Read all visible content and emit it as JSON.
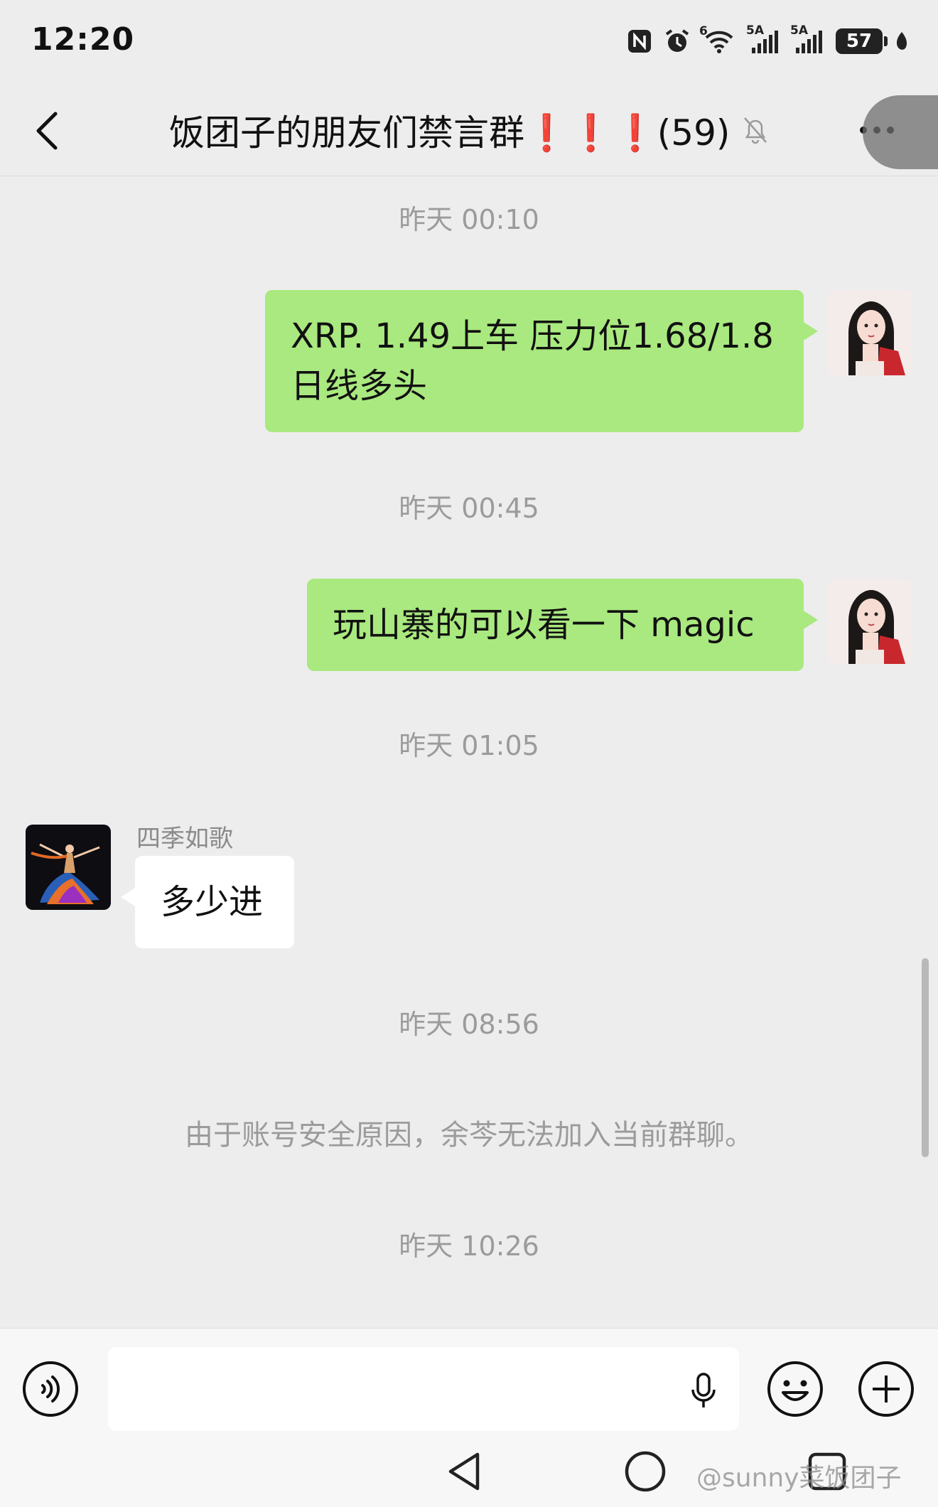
{
  "status_bar": {
    "time": "12:20",
    "battery": "57",
    "wifi_label": "6",
    "signal1_label": "5A",
    "signal2_label": "5A"
  },
  "header": {
    "title": "饭团子的朋友们禁言群❗❗❗(59)"
  },
  "messages": [
    {
      "type": "timestamp",
      "text": "昨天 00:10"
    },
    {
      "type": "mine",
      "line1": "XRP. 1.49上车  压力位1.68/1.8",
      "line2": "日线多头"
    },
    {
      "type": "timestamp",
      "text": "昨天 00:45"
    },
    {
      "type": "mine",
      "text": "玩山寨的可以看一下  magic"
    },
    {
      "type": "timestamp",
      "text": "昨天 01:05"
    },
    {
      "type": "other",
      "sender": "四季如歌",
      "text": "多少进"
    },
    {
      "type": "timestamp",
      "text": "昨天 08:56"
    },
    {
      "type": "system",
      "text": "由于账号安全原因，余芩无法加入当前群聊。"
    },
    {
      "type": "timestamp",
      "text": "昨天 10:26"
    }
  ],
  "input": {
    "value": "",
    "placeholder": ""
  },
  "watermark": "@sunny菜饭团子",
  "colors": {
    "background": "#ededed",
    "my_bubble": "#a9e97f",
    "other_bubble": "#ffffff",
    "timestamp_text": "#9b9b9b"
  }
}
